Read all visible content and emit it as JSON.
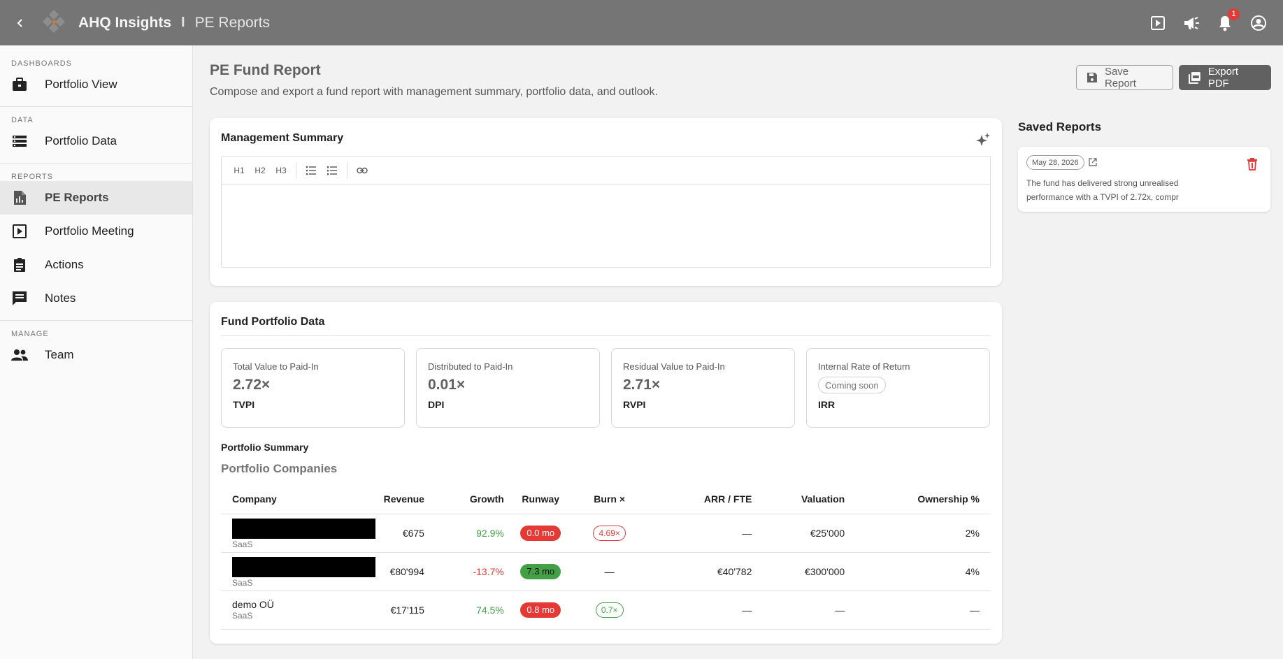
{
  "header": {
    "app_title": "AHQ Insights",
    "separator": "I",
    "page": "PE Reports",
    "notification_count": "1",
    "icons": [
      "back-arrow-icon",
      "logo-icon",
      "present-icon",
      "megaphone-icon",
      "bell-icon",
      "account-icon"
    ]
  },
  "sidebar": {
    "sections": [
      {
        "label": "DASHBOARDS",
        "items": [
          {
            "label": "Portfolio View",
            "icon": "briefcase-icon"
          }
        ]
      },
      {
        "label": "DATA",
        "items": [
          {
            "label": "Portfolio Data",
            "icon": "storage-icon"
          }
        ]
      },
      {
        "label": "REPORTS",
        "items": [
          {
            "label": "PE Reports",
            "icon": "report-icon",
            "active": true
          },
          {
            "label": "Portfolio Meeting",
            "icon": "slideshow-icon"
          },
          {
            "label": "Actions",
            "icon": "clipboard-icon"
          },
          {
            "label": "Notes",
            "icon": "comment-icon"
          }
        ]
      },
      {
        "label": "MANAGE",
        "items": [
          {
            "label": "Team",
            "icon": "people-icon"
          }
        ]
      }
    ]
  },
  "main": {
    "title": "PE Fund Report",
    "subtitle": "Compose and export a fund report with management summary, portfolio data, and outlook.",
    "save_button": "Save Report",
    "export_button": "Export PDF",
    "summary": {
      "title": "Management Summary",
      "toolbar": [
        "H1",
        "H2",
        "H3"
      ],
      "content": ""
    },
    "portfolio": {
      "title": "Fund Portfolio Data",
      "kpis": [
        {
          "label": "Total Value to Paid-In",
          "value": "2.72×",
          "abbr": "TVPI"
        },
        {
          "label": "Distributed to Paid-In",
          "value": "0.01×",
          "abbr": "DPI"
        },
        {
          "label": "Residual Value to Paid-In",
          "value": "2.71×",
          "abbr": "RVPI"
        },
        {
          "label": "Internal Rate of Return",
          "chip": "Coming soon",
          "abbr": "IRR"
        }
      ],
      "summary_label": "Portfolio Summary",
      "companies_label": "Portfolio Companies",
      "columns": [
        "Company",
        "Revenue",
        "Growth",
        "Runway",
        "Burn ×",
        "ARR / FTE",
        "Valuation",
        "Ownership %"
      ],
      "rows": [
        {
          "name": "",
          "type": "SaaS",
          "revenue": "€675",
          "growth": "92.9%",
          "growth_sign": "pos",
          "runway": "0.0 mo",
          "runway_status": "red",
          "burn": "4.69×",
          "burn_status": "red",
          "arr_fte": "—",
          "valuation": "€25'000",
          "ownership": "2%"
        },
        {
          "name": "",
          "type": "SaaS",
          "revenue": "€80'994",
          "growth": "-13.7%",
          "growth_sign": "neg",
          "runway": "7.3 mo",
          "runway_status": "green",
          "burn": "—",
          "burn_status": "none",
          "arr_fte": "€40'782",
          "valuation": "€300'000",
          "ownership": "4%"
        },
        {
          "name": "demo OÜ",
          "type": "SaaS",
          "revenue": "€17'115",
          "growth": "74.5%",
          "growth_sign": "pos",
          "runway": "0.8 mo",
          "runway_status": "red",
          "burn": "0.7×",
          "burn_status": "green",
          "arr_fte": "—",
          "valuation": "—",
          "ownership": "—"
        }
      ]
    }
  },
  "saved_reports": {
    "title": "Saved Reports",
    "items": [
      {
        "date": "May 28, 2026",
        "snippet": "The fund has delivered strong unrealised performance with a TVPI of 2.72x, compr"
      }
    ]
  },
  "colors": {
    "topbar": "#757575",
    "accent_red": "#e53935",
    "accent_green": "#43a047"
  }
}
